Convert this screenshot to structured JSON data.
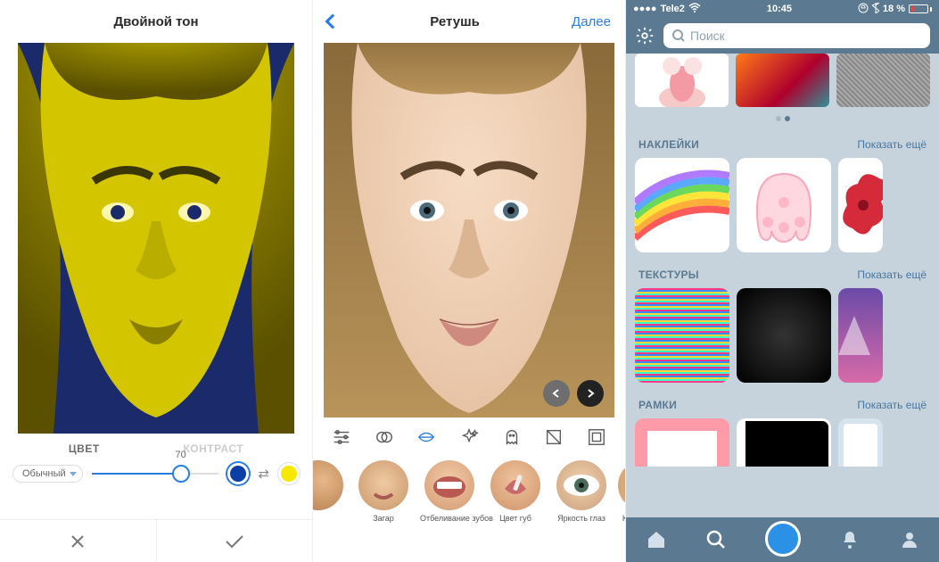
{
  "panel1": {
    "title": "Двойной тон",
    "tabs": {
      "color": "ЦВЕТ",
      "contrast": "КОНТРАСТ"
    },
    "slider_value": "70",
    "mode_label": "Обычный",
    "colors": {
      "primary": "#0b3fa5",
      "secondary": "#f7e800"
    }
  },
  "panel2": {
    "title": "Ретушь",
    "next": "Далее",
    "tools": [
      "settings",
      "blend",
      "lips",
      "sparkle",
      "ghost",
      "sharpen",
      "frame"
    ],
    "thumbs": [
      {
        "label": "Загар"
      },
      {
        "label": "Отбеливание зубов"
      },
      {
        "label": "Цвет губ"
      },
      {
        "label": "Яркость глаз"
      },
      {
        "label": "Кр"
      }
    ]
  },
  "panel3": {
    "status": {
      "carrier": "Tele2",
      "time": "10:45",
      "battery_pct": "18 %"
    },
    "search_placeholder": "Поиск",
    "sections": {
      "stickers": {
        "title": "НАКЛЕЙКИ",
        "more": "Показать ещё"
      },
      "textures": {
        "title": "ТЕКСТУРЫ",
        "more": "Показать ещё"
      },
      "frames": {
        "title": "РАМКИ",
        "more": "Показать ещё"
      }
    }
  }
}
